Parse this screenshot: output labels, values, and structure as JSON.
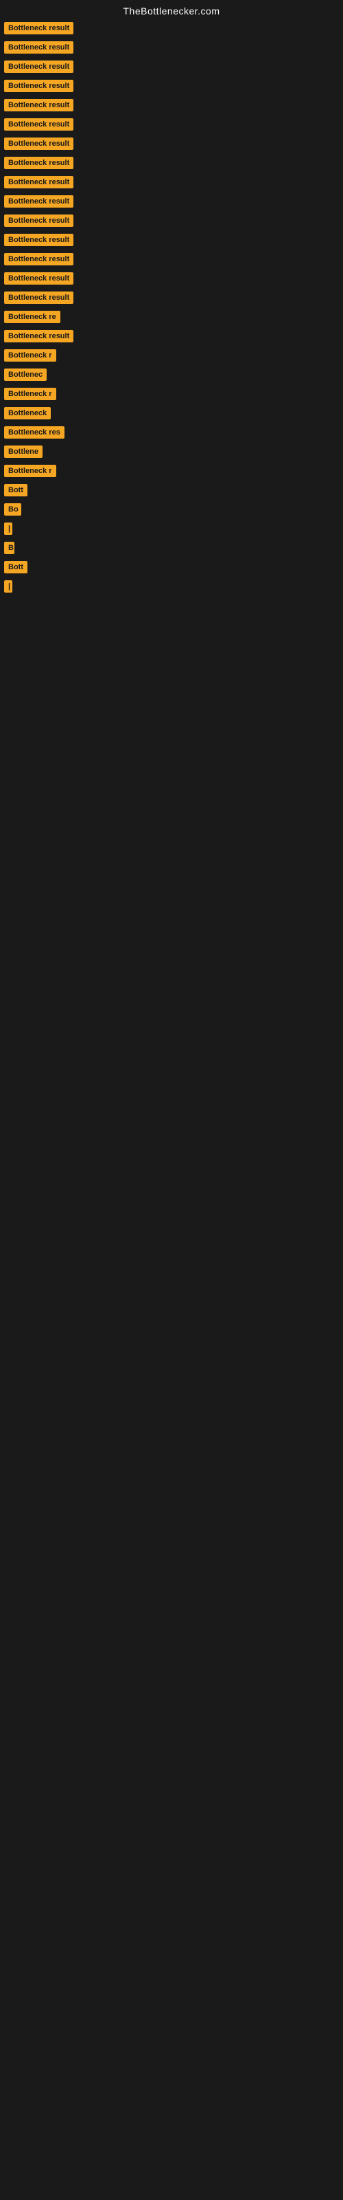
{
  "site": {
    "title": "TheBottlenecker.com"
  },
  "items": [
    {
      "label": "Bottleneck result",
      "width": 120
    },
    {
      "label": "Bottleneck result",
      "width": 115
    },
    {
      "label": "Bottleneck result",
      "width": 110
    },
    {
      "label": "Bottleneck result",
      "width": 108
    },
    {
      "label": "Bottleneck result",
      "width": 112
    },
    {
      "label": "Bottleneck result",
      "width": 109
    },
    {
      "label": "Bottleneck result",
      "width": 107
    },
    {
      "label": "Bottleneck result",
      "width": 110
    },
    {
      "label": "Bottleneck result",
      "width": 114
    },
    {
      "label": "Bottleneck result",
      "width": 108
    },
    {
      "label": "Bottleneck result",
      "width": 112
    },
    {
      "label": "Bottleneck result",
      "width": 105
    },
    {
      "label": "Bottleneck result",
      "width": 103
    },
    {
      "label": "Bottleneck result",
      "width": 104
    },
    {
      "label": "Bottleneck result",
      "width": 103
    },
    {
      "label": "Bottleneck re",
      "width": 90
    },
    {
      "label": "Bottleneck result",
      "width": 103
    },
    {
      "label": "Bottleneck r",
      "width": 82
    },
    {
      "label": "Bottlenec",
      "width": 72
    },
    {
      "label": "Bottleneck r",
      "width": 82
    },
    {
      "label": "Bottleneck",
      "width": 75
    },
    {
      "label": "Bottleneck res",
      "width": 92
    },
    {
      "label": "Bottlene",
      "width": 65
    },
    {
      "label": "Bottleneck r",
      "width": 80
    },
    {
      "label": "Bott",
      "width": 38
    },
    {
      "label": "Bo",
      "width": 25
    },
    {
      "label": "|",
      "width": 8
    },
    {
      "label": "B",
      "width": 15
    },
    {
      "label": "Bott",
      "width": 38
    },
    {
      "label": "|",
      "width": 8
    }
  ]
}
